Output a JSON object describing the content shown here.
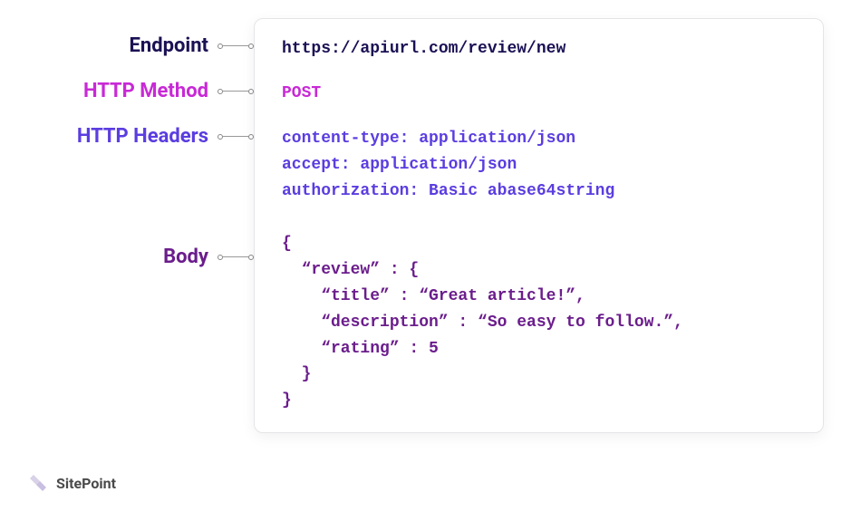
{
  "labels": {
    "endpoint": "Endpoint",
    "method": "HTTP Method",
    "headers": "HTTP Headers",
    "body": "Body"
  },
  "request": {
    "endpoint": "https://apiurl.com/review/new",
    "method": "POST",
    "headers": {
      "content_type": "content-type: application/json",
      "accept": "accept: application/json",
      "authorization": "authorization: Basic abase64string"
    },
    "body": "{\n  “review” : {\n    “title” : “Great article!”,\n    “description” : “So easy to follow.”,\n    “rating” : 5\n  }\n}"
  },
  "footer": {
    "brand": "SitePoint"
  },
  "spacing": {
    "label_top_endpoint": "0px",
    "label_top_method": "27px",
    "label_top_headers": "27px",
    "label_top_body": "108px"
  }
}
